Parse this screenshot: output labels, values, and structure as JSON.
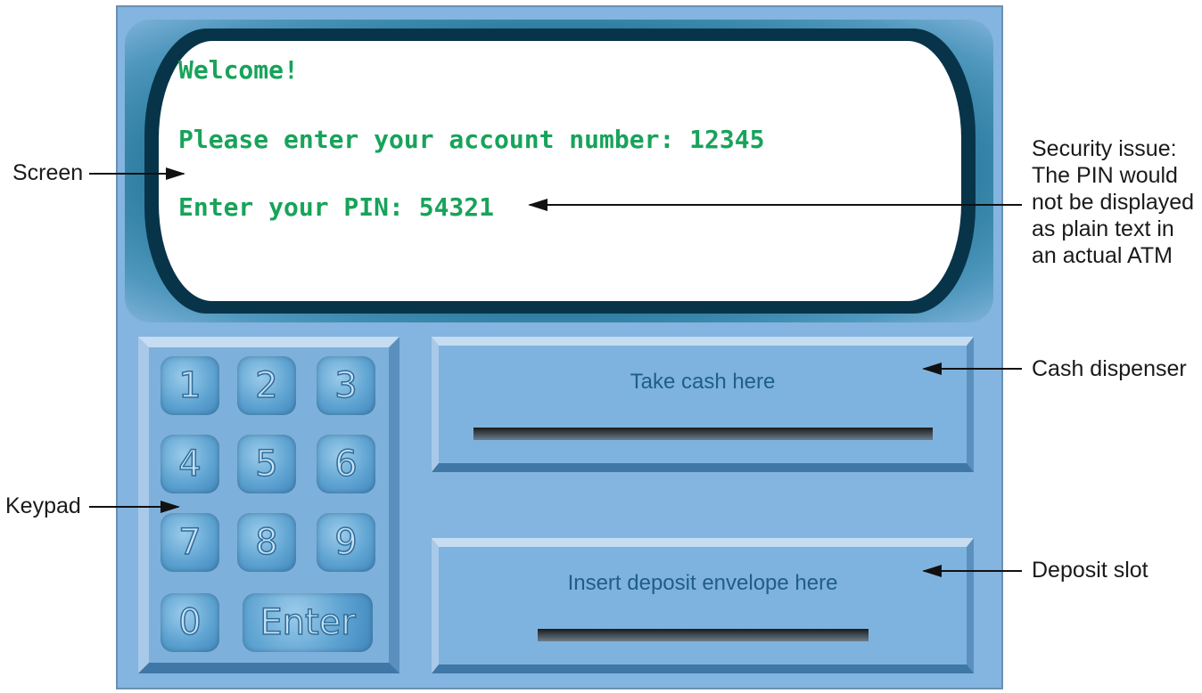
{
  "screen": {
    "line1": "Welcome!",
    "line2": "Please enter your account number: 12345",
    "line3": "Enter your PIN: 54321"
  },
  "keypad": {
    "keys": [
      "1",
      "2",
      "3",
      "4",
      "5",
      "6",
      "7",
      "8",
      "9",
      "0"
    ],
    "enter_label": "Enter"
  },
  "cash_dispenser": {
    "label": "Take cash here"
  },
  "deposit_slot": {
    "label": "Insert deposit envelope here"
  },
  "annotations": {
    "screen": "Screen",
    "keypad": "Keypad",
    "security_line1": "Security issue:",
    "security_line2": "The PIN would",
    "security_line3": "not be displayed",
    "security_line4": "as plain text in",
    "security_line5": "an actual ATM",
    "cash_dispenser": "Cash dispenser",
    "deposit_slot": "Deposit slot"
  },
  "colors": {
    "screen_text": "#17a35a",
    "atm_body": "#84b4e0"
  }
}
